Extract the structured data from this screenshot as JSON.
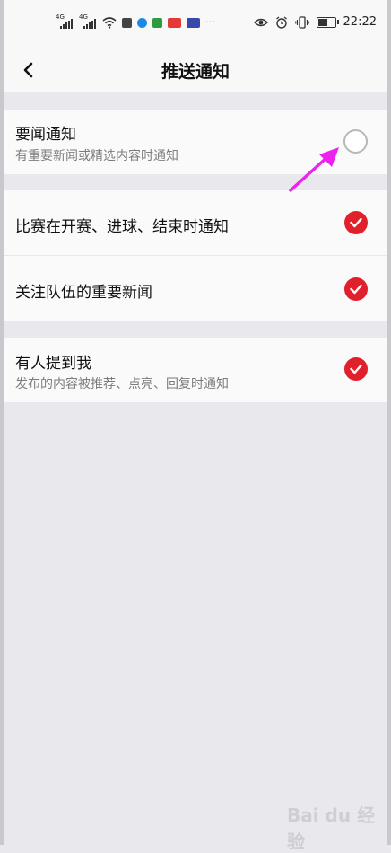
{
  "status_bar": {
    "net1": "4G",
    "net2": "4G",
    "time": "22:22",
    "more": "···"
  },
  "nav": {
    "back_icon": "chevron-left-icon",
    "title": "推送通知"
  },
  "settings": [
    {
      "title": "要闻通知",
      "subtitle": "有重要新闻或精选内容时通知",
      "checked": false
    },
    {
      "title": "比赛在开赛、进球、结束时通知",
      "subtitle": "",
      "checked": true
    },
    {
      "title": "关注队伍的重要新闻",
      "subtitle": "",
      "checked": true
    },
    {
      "title": "有人提到我",
      "subtitle": "发布的内容被推荐、点亮、回复时通知",
      "checked": true
    }
  ],
  "colors": {
    "accent": "#e0202b",
    "annotation_arrow": "#ee22ee"
  },
  "watermark": "Bai du 经验"
}
